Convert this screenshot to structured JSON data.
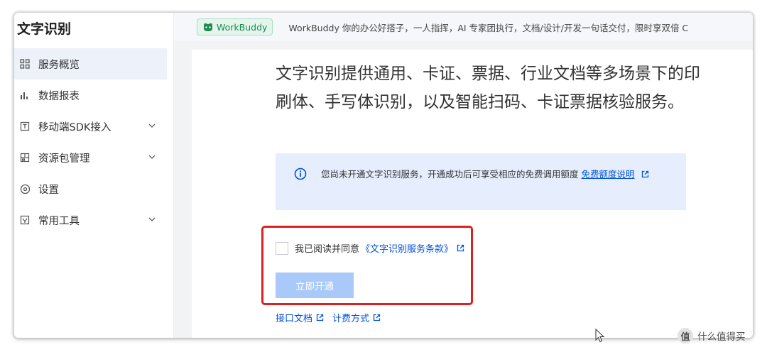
{
  "sidebar": {
    "title": "文字识别",
    "items": [
      {
        "label": "服务概览",
        "icon": "grid-icon",
        "active": true
      },
      {
        "label": "数据报表",
        "icon": "bar-chart-icon"
      },
      {
        "label": "移动端SDK接入",
        "icon": "sdk-icon",
        "has_submenu": true
      },
      {
        "label": "资源包管理",
        "icon": "package-icon",
        "has_submenu": true
      },
      {
        "label": "设置",
        "icon": "gear-icon"
      },
      {
        "label": "常用工具",
        "icon": "tool-icon",
        "has_submenu": true
      }
    ]
  },
  "banner": {
    "badge": "WorkBuddy",
    "text": "WorkBuddy 你的办公好搭子，一人指挥，AI 专家团执行，文档/设计/开发一句话交付，限时享双倍 C"
  },
  "main": {
    "description": "文字识别提供通用、卡证、票据、行业文档等多场景下的印刷体、手写体识别，以及智能扫码、卡证票据核验服务。",
    "notice": {
      "text": "您尚未开通文字识别服务，开通成功后可享受相应的免费调用额度",
      "link": "免费额度说明"
    },
    "agreement": {
      "prefix": "我已阅读并同意",
      "link": "《文字识别服务条款》"
    },
    "open_button": "立即开通",
    "footer_links": [
      "接口文档",
      "计费方式"
    ]
  },
  "watermark": {
    "logo_char": "值",
    "text": "什么值得买"
  },
  "colors": {
    "accent": "#0052d9",
    "highlight_border": "#e02020",
    "notice_bg": "#e6eefd",
    "button_disabled": "#a9c9f8"
  }
}
